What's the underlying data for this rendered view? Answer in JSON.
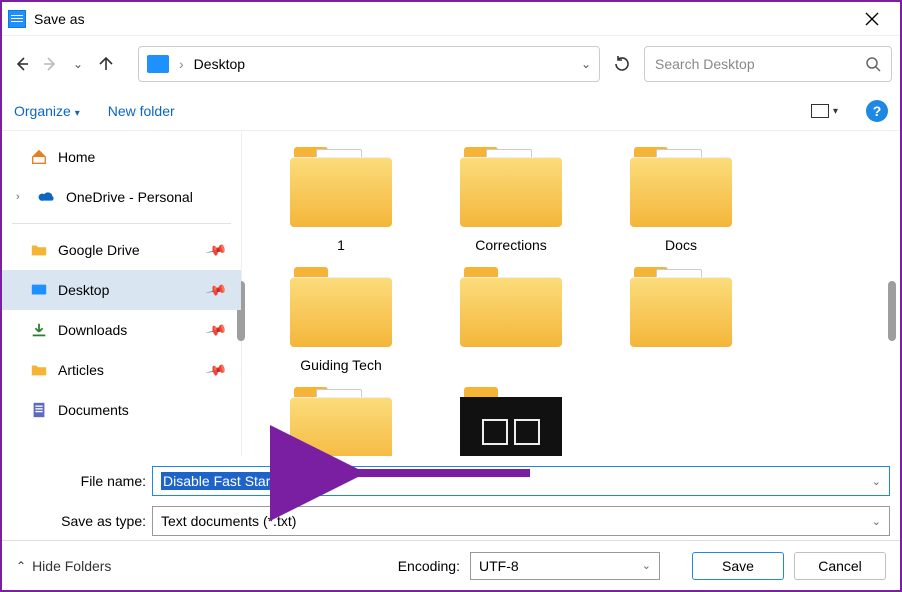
{
  "window": {
    "title": "Save as"
  },
  "address": {
    "location": "Desktop"
  },
  "search": {
    "placeholder": "Search Desktop"
  },
  "toolbar": {
    "organize": "Organize",
    "new_folder": "New folder"
  },
  "sidebar": {
    "home": "Home",
    "onedrive": "OneDrive - Personal",
    "items": [
      {
        "label": "Google Drive"
      },
      {
        "label": "Desktop"
      },
      {
        "label": "Downloads"
      },
      {
        "label": "Articles"
      },
      {
        "label": "Documents"
      }
    ]
  },
  "content": {
    "items": [
      {
        "label": "1",
        "kind": "folder-blank"
      },
      {
        "label": "Corrections",
        "kind": "folder-pdf"
      },
      {
        "label": "Docs",
        "kind": "folder-pdf"
      },
      {
        "label": "Guiding Tech",
        "kind": "folder"
      },
      {
        "label": "",
        "kind": "folder"
      },
      {
        "label": "",
        "kind": "folder-pdf"
      },
      {
        "label": "",
        "kind": "folder-pdf"
      },
      {
        "label": "",
        "kind": "folder-dark"
      }
    ]
  },
  "fields": {
    "file_name_label": "File name:",
    "file_name_value": "Disable Fast Startup.reg",
    "save_type_label": "Save as type:",
    "save_type_value": "Text documents (*.txt)"
  },
  "footer": {
    "hide_folders": "Hide Folders",
    "encoding_label": "Encoding:",
    "encoding_value": "UTF-8",
    "save": "Save",
    "cancel": "Cancel"
  }
}
